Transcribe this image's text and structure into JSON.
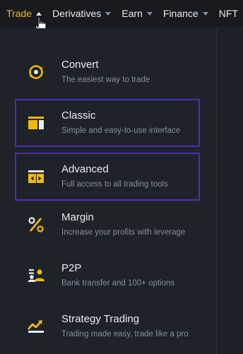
{
  "nav": {
    "items": [
      {
        "label": "Trade",
        "active": true,
        "caret": "up"
      },
      {
        "label": "Derivatives",
        "active": false,
        "caret": "down"
      },
      {
        "label": "Earn",
        "active": false,
        "caret": "down"
      },
      {
        "label": "Finance",
        "active": false,
        "caret": "down"
      },
      {
        "label": "NFT",
        "active": false,
        "caret": "down"
      }
    ]
  },
  "menu": {
    "items": [
      {
        "title": "Convert",
        "desc": "The easiest way to trade",
        "icon": "convert-icon"
      },
      {
        "title": "Classic",
        "desc": "Simple and easy-to-use interface",
        "icon": "classic-layout-icon",
        "highlighted": true
      },
      {
        "title": "Advanced",
        "desc": "Full access to all trading tools",
        "icon": "advanced-layout-icon",
        "highlighted": true
      },
      {
        "title": "Margin",
        "desc": "Increase your profits with leverage",
        "icon": "margin-percent-icon"
      },
      {
        "title": "P2P",
        "desc": "Bank transfer and 100+ options",
        "icon": "p2p-users-icon"
      },
      {
        "title": "Strategy Trading",
        "desc": "Trading made easy, trade like a pro",
        "icon": "strategy-chart-icon"
      }
    ]
  },
  "colors": {
    "accent": "#f0b90b",
    "highlight_border": "#4f2bb6",
    "panel_bg": "#1e2329",
    "nav_bg": "#181a20",
    "text_primary": "#eaecef",
    "text_secondary": "#848e9c"
  }
}
